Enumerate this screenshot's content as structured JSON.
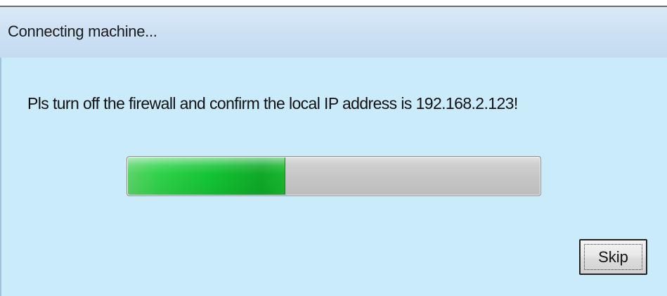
{
  "window": {
    "title": "Connecting machine..."
  },
  "message": {
    "text": "Pls turn off the firewall and confirm the local IP address is 192.168.2.123!"
  },
  "progress": {
    "value_fraction": 0.38,
    "fill_color": "#12c232",
    "track_color": "#c4c4c4"
  },
  "buttons": {
    "skip_label": "Skip"
  },
  "colors": {
    "content_background": "#c9ebfa",
    "title_bar_background": "#cfe2f4"
  }
}
